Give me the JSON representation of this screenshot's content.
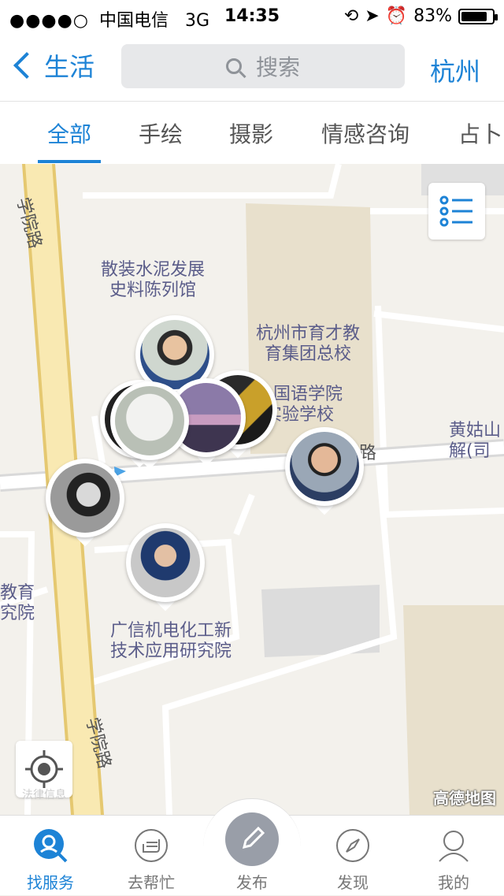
{
  "status_bar": {
    "carrier": "中国电信",
    "signal_dots": "●●●●○",
    "network": "3G",
    "time": "14:35",
    "battery": "83%",
    "battery_level": 0.83
  },
  "navbar": {
    "back_label": "生活",
    "search_placeholder": "搜索",
    "city": "杭州"
  },
  "tabs": [
    {
      "label": "全部",
      "active": true
    },
    {
      "label": "手绘",
      "active": false
    },
    {
      "label": "摄影",
      "active": false
    },
    {
      "label": "情感咨询",
      "active": false
    },
    {
      "label": "占卜",
      "active": false
    }
  ],
  "map": {
    "labels": {
      "road_west_top": "学院路",
      "road_west_bottom": "学院路",
      "museum": "散装水泥发展\n史料陈列馆",
      "school_group": "杭州市育才教\n育集团总校",
      "foreign_school": "外国语学院\n实验学校",
      "road_mid": "路",
      "huanggushan": "黄姑山\n解(司",
      "guangxin": "广信机电化工新\n技术应用研究院",
      "edu_left": "教育\n究院",
      "locate_caption": "法律信息"
    },
    "attribution": "高德地图",
    "colors": {
      "background": "#f3f1ec",
      "road_main": "#f9e9b2",
      "road_main_border": "#e5c870",
      "block": "#e8e0cc",
      "gray_block": "#dcdcdc"
    }
  },
  "tab_bar": {
    "items": [
      {
        "label": "找服务",
        "icon": "find-service-icon",
        "active": true
      },
      {
        "label": "去帮忙",
        "icon": "help-hand-icon",
        "active": false
      },
      {
        "label": "发布",
        "icon": "pencil-icon",
        "active": false
      },
      {
        "label": "发现",
        "icon": "compass-icon",
        "active": false
      },
      {
        "label": "我的",
        "icon": "user-icon",
        "active": false
      }
    ],
    "accent": "#1d83d6"
  }
}
